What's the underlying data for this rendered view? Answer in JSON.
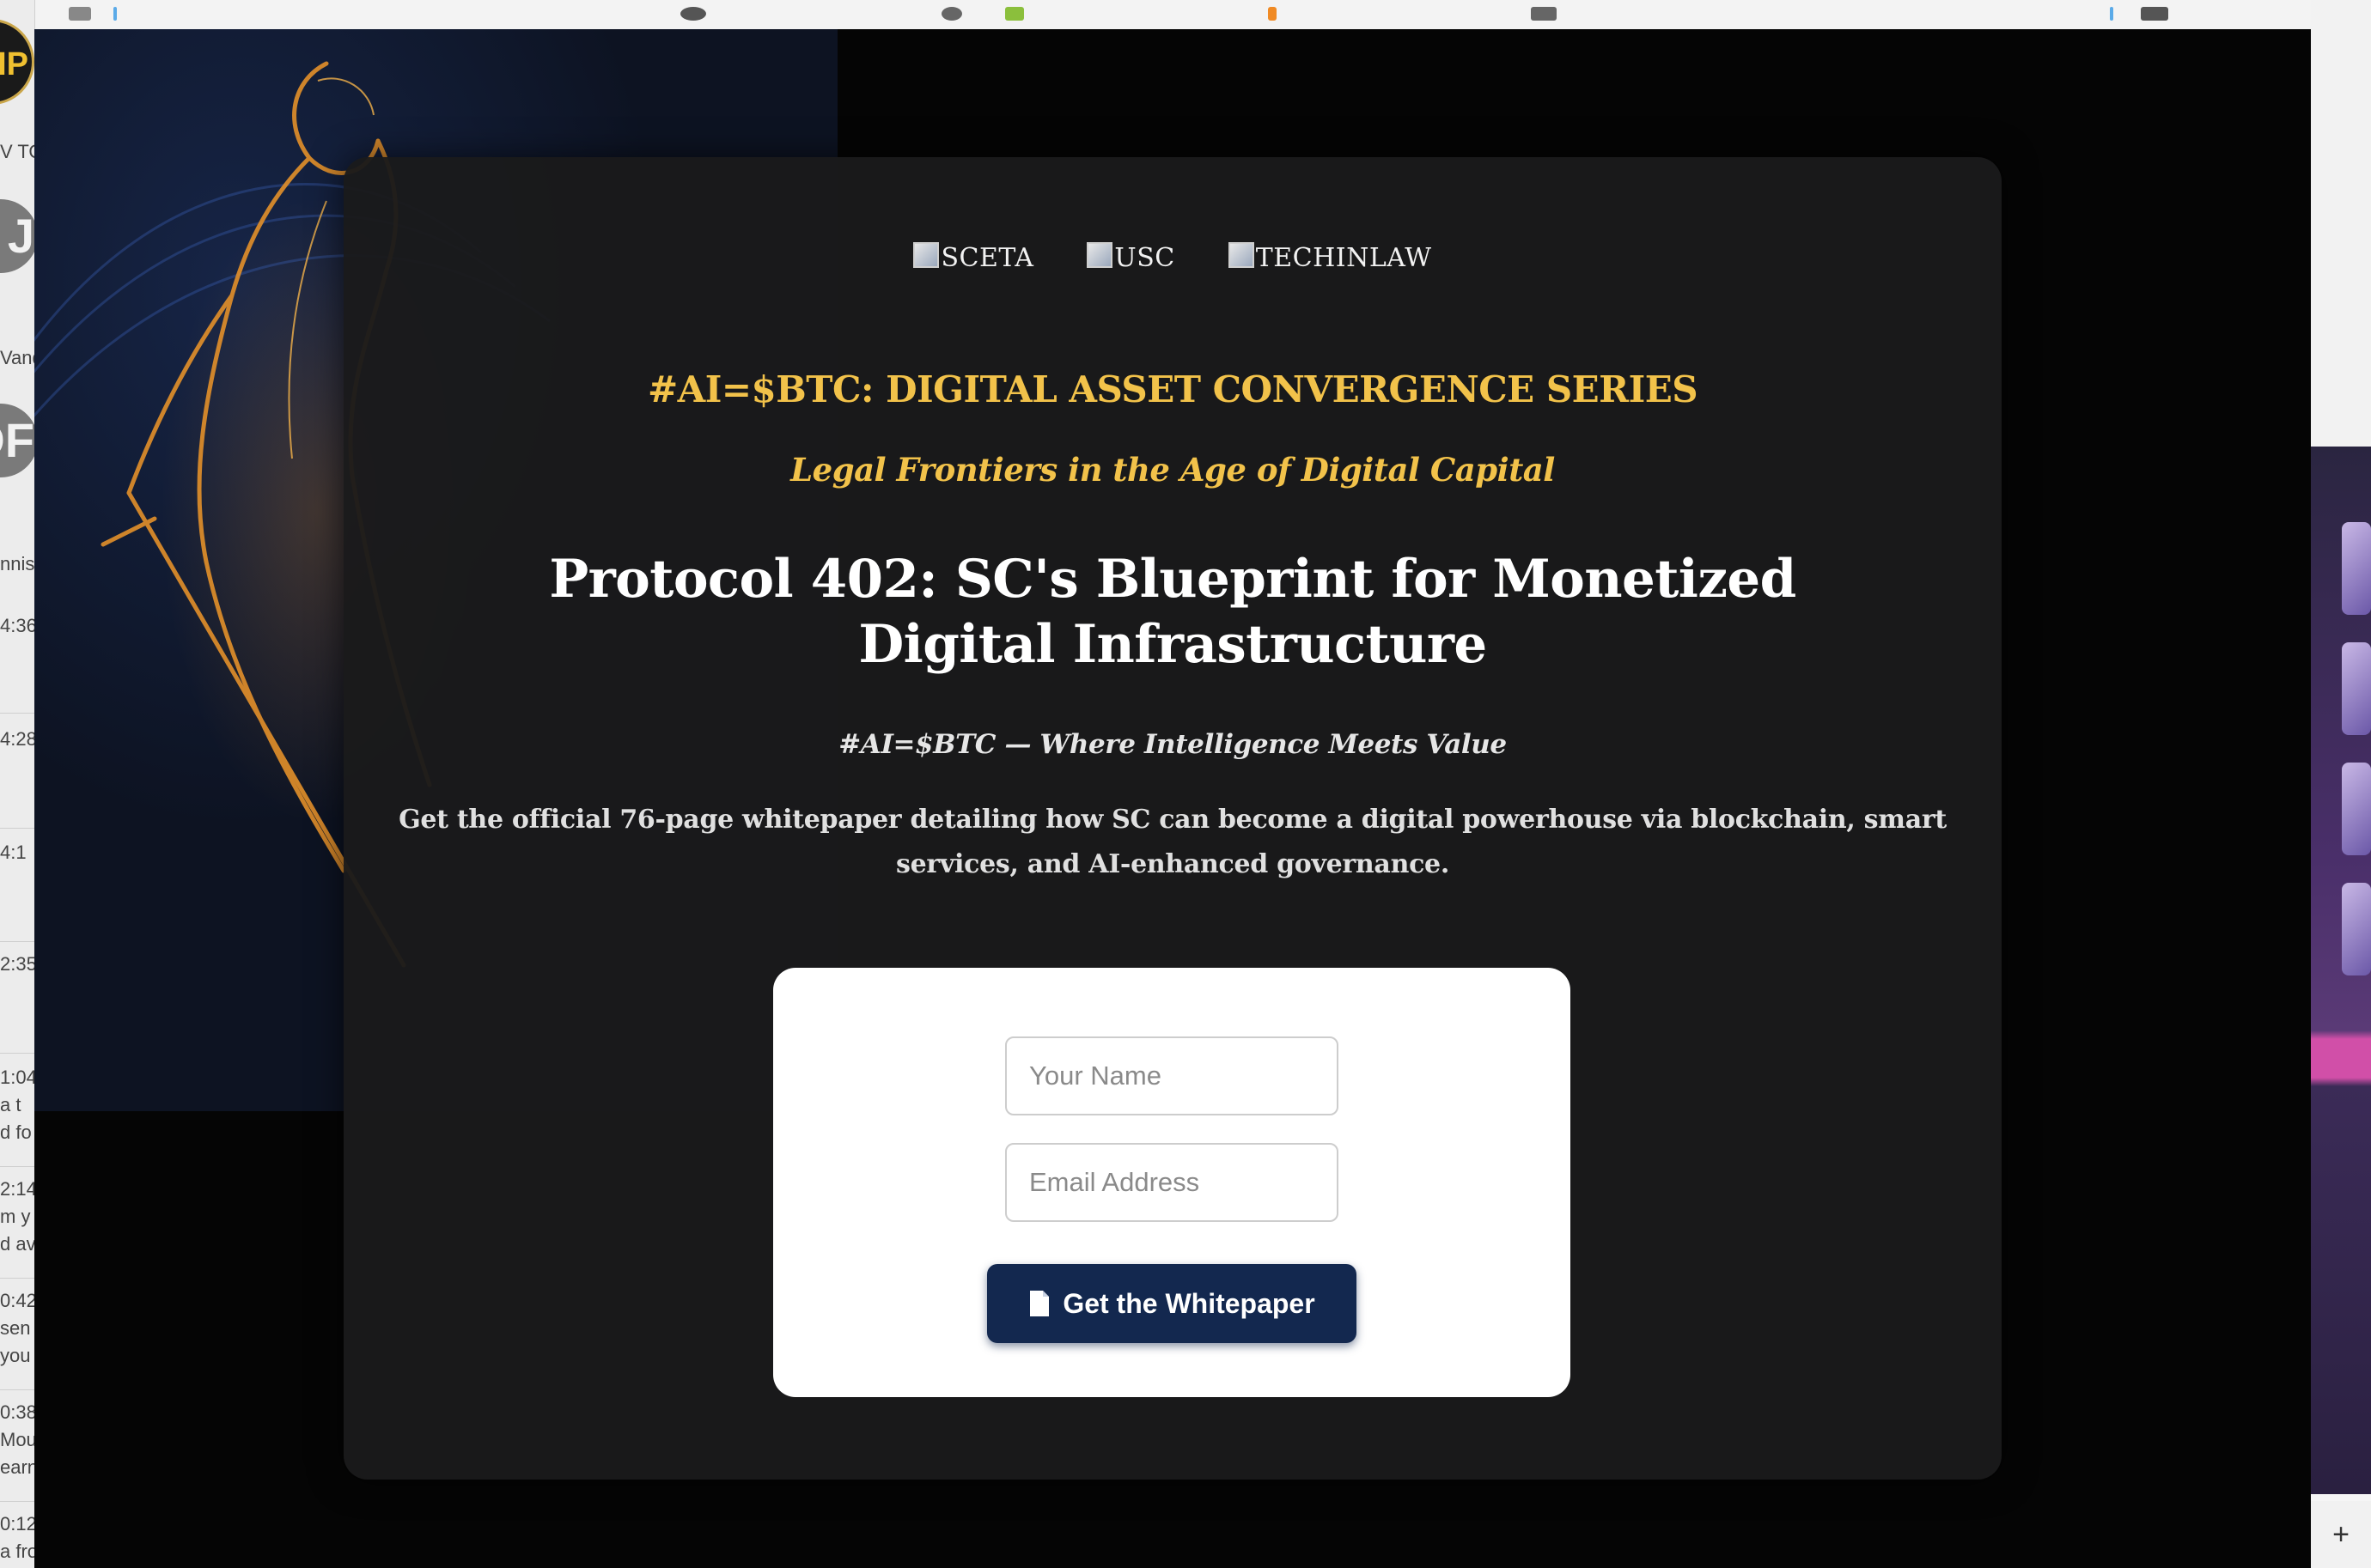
{
  "logos": [
    {
      "alt": "SCETA"
    },
    {
      "alt": "USC"
    },
    {
      "alt": "TECHINLAW"
    }
  ],
  "series_title": "#AI=$BTC: DIGITAL ASSET CONVERGENCE SERIES",
  "series_subtitle": "Legal Frontiers in the Age of Digital Capital",
  "heading": "Protocol 402: SC's Blueprint for Monetized Digital Infrastructure",
  "tagline": "#AI=$BTC — Where Intelligence Meets Value",
  "description": "Get the official 76-page whitepaper detailing how SC can become a digital powerhouse via blockchain, smart services, and AI-enhanced governance.",
  "form": {
    "name_placeholder": "Your Name",
    "email_placeholder": "Email Address",
    "submit_label": "Get the Whitepaper",
    "submit_icon": "document-icon"
  },
  "left_edge": {
    "logo_text": "IP",
    "top_snippet": "V TO",
    "avatars": [
      "J",
      "DF"
    ],
    "names": [
      "Vand",
      "nnis"
    ],
    "times": [
      "4:36",
      "4:28",
      "4:1",
      "2:35",
      "1:04",
      "2:14",
      "0:42",
      "0:38",
      "0:12"
    ],
    "snippets": [
      " a t",
      "d fo",
      "m y",
      "d av",
      "sen",
      "you",
      "Mou",
      "earn",
      "a fro"
    ]
  },
  "new_tab_label": "+",
  "colors": {
    "accent_gold": "#f2c24a",
    "button_navy": "#13284f",
    "card_bg": "#1a1a1b"
  }
}
